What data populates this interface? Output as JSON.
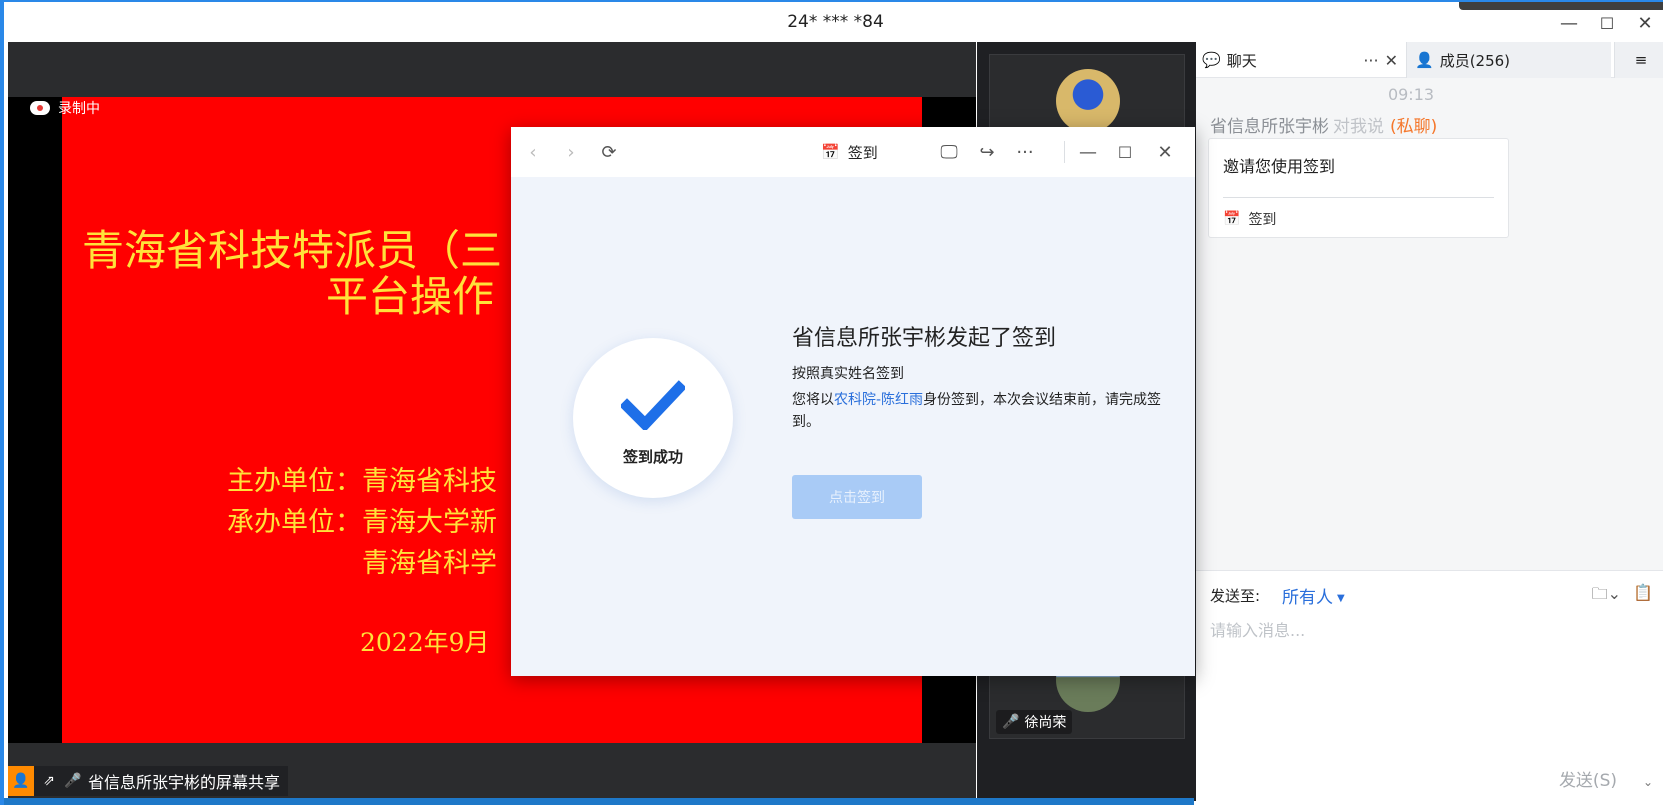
{
  "window": {
    "title": "24* *** *84",
    "controls": {
      "minimize": "—",
      "maximize": "☐",
      "close": "✕"
    }
  },
  "share": {
    "recording_label": "录制中",
    "presenter_label": "省信息所张宇彬的屏幕共享",
    "slide": {
      "title_line1": "青海省科技特派员（三",
      "title_line2": "平台操作",
      "organizer": "主办单位：青海省科技",
      "co_organizer": "承办单位：青海大学新",
      "co_organizer2": "青海省科学",
      "date": "2022年9月"
    }
  },
  "participants": {
    "tile2_name": "徐尚荣"
  },
  "dialog": {
    "title": "签到",
    "status_label": "签到成功",
    "heading": "省信息所张宇彬发起了签到",
    "line1": "按照真实姓名签到",
    "line2_prefix": "您将以",
    "line2_name": "农科院-陈红雨",
    "line2_suffix": "身份签到，本次会议结束前，请完成签到。",
    "button": "点击签到"
  },
  "chat": {
    "tab_chat": "聊天",
    "tab_members": "成员(256)",
    "time": "09:13",
    "sender": "省信息所张宇彬",
    "to_me": "对我说",
    "private": "(私聊)",
    "card_message": "邀请您使用签到",
    "card_action": "签到",
    "send_to_label": "发送至:",
    "recipient": "所有人",
    "input_placeholder": "请输入消息...",
    "send_button": "发送(S)"
  },
  "colors": {
    "accent": "#2a6fdb",
    "slide_bg": "#ff0000",
    "slide_text": "#ffe23a",
    "private": "#f5762a",
    "button_disabled": "#a9cbf6"
  }
}
